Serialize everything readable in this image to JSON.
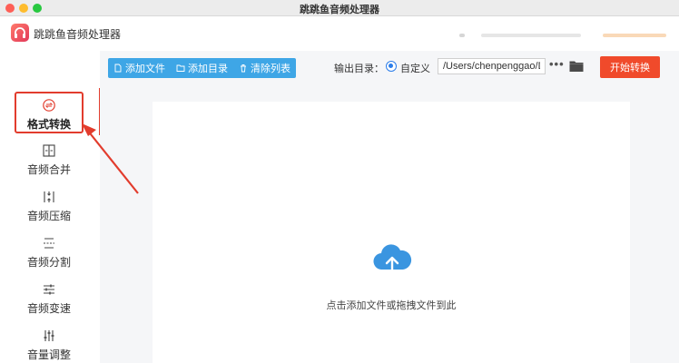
{
  "window": {
    "title": "跳跳鱼音频处理器"
  },
  "app": {
    "name": "跳跳鱼音频处理器"
  },
  "sidebar": {
    "items": [
      {
        "label": "格式转换",
        "icon": "format-convert-icon",
        "active": true
      },
      {
        "label": "音频合并",
        "icon": "merge-icon",
        "active": false
      },
      {
        "label": "音频压缩",
        "icon": "compress-icon",
        "active": false
      },
      {
        "label": "音频分割",
        "icon": "split-icon",
        "active": false
      },
      {
        "label": "音频变速",
        "icon": "speed-icon",
        "active": false
      },
      {
        "label": "音量调整",
        "icon": "volume-icon",
        "active": false
      }
    ]
  },
  "toolbar": {
    "add_file": "添加文件",
    "add_dir": "添加目录",
    "clear_list": "清除列表",
    "output_label": "输出目录：",
    "radio_label": "自定义",
    "output_path": "/Users/chenpenggao/D",
    "more": "•••",
    "start": "开始转换"
  },
  "main": {
    "drop_hint": "点击添加文件或拖拽文件到此"
  },
  "colors": {
    "accent_blue": "#3ea6e6",
    "start_red": "#f04a2b",
    "annotation_red": "#e23c2d",
    "cloud_blue": "#3a95e0"
  }
}
